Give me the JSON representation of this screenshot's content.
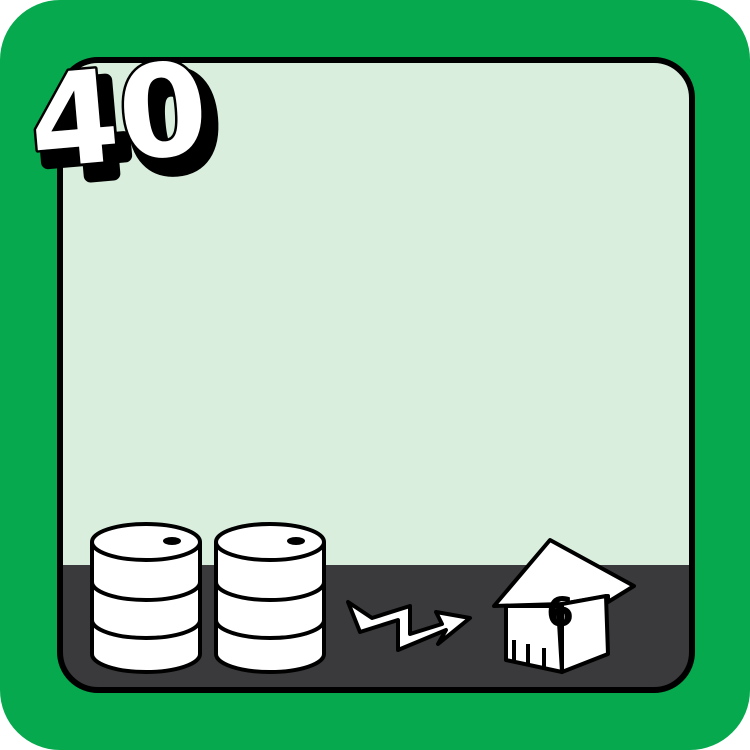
{
  "card": {
    "cost": "40",
    "fuel_type": "oil",
    "fuel_count": 2,
    "cities_powered": "6",
    "colors": {
      "border": "#06a94d",
      "panel": "#daeedd",
      "bottom_band": "#3a3a3c",
      "outline": "#000000",
      "icon_fill": "#ffffff"
    },
    "icons": {
      "fuel": "oil-barrel-icon",
      "power": "lightning-arrow-icon",
      "city": "house-icon"
    }
  }
}
